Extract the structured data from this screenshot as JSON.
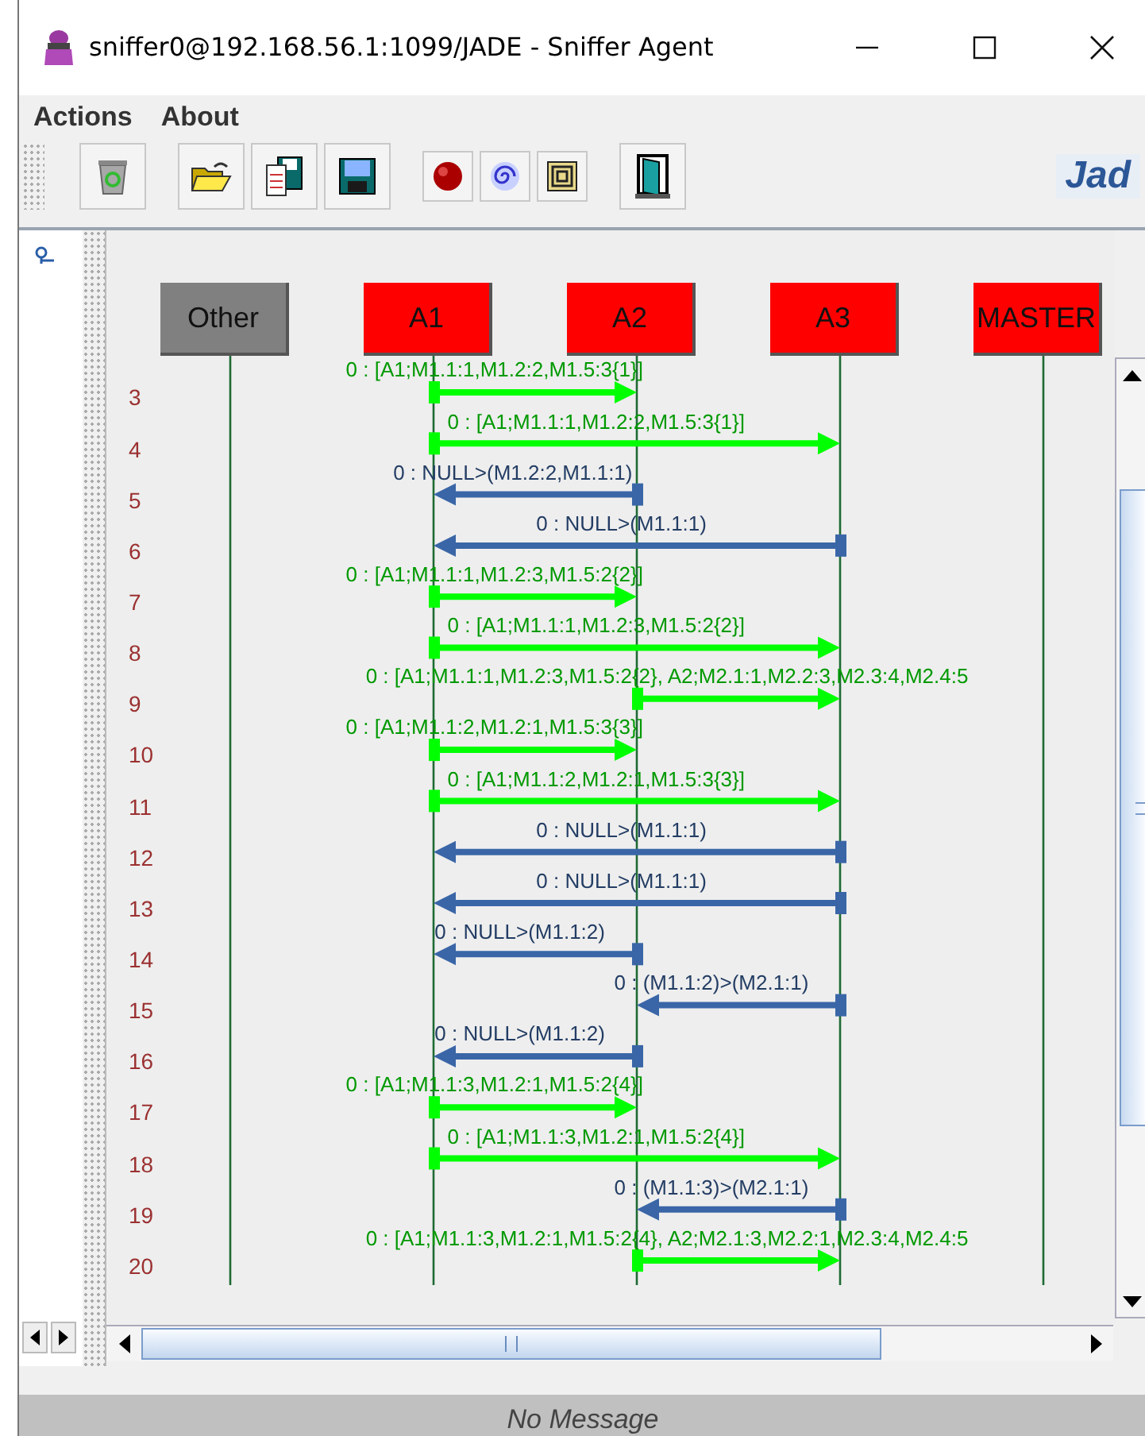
{
  "window": {
    "title": "sniffer0@192.168.56.1:1099/JADE - Sniffer Agent"
  },
  "menu": [
    "Actions",
    "About"
  ],
  "logo": "Jad",
  "agents": [
    {
      "name": "Other",
      "color": "#808080"
    },
    {
      "name": "A1",
      "color": "#ff0000"
    },
    {
      "name": "A2",
      "color": "#ff0000"
    },
    {
      "name": "A3",
      "color": "#ff0000"
    },
    {
      "name": "MASTER",
      "color": "#ff0000"
    }
  ],
  "messages": [
    {
      "row": "3",
      "kind": "a1toa2",
      "label": "0 : [A1;M1.1:1,M1.2:2,M1.5:3{1}]",
      "color": "#00ff00"
    },
    {
      "row": "4",
      "kind": "a1toa3",
      "label": "0 : [A1;M1.1:1,M1.2:2,M1.5:3{1}]",
      "color": "#00ff00"
    },
    {
      "row": "5",
      "kind": "a2toa1",
      "label": "0 : NULL>(M1.2:2,M1.1:1)",
      "color": "#3a66a7"
    },
    {
      "row": "6",
      "kind": "a3toa1",
      "label": "0 : NULL>(M1.1:1)",
      "color": "#3a66a7"
    },
    {
      "row": "7",
      "kind": "a1toa2",
      "label": "0 : [A1;M1.1:1,M1.2:3,M1.5:2{2}]",
      "color": "#00ff00"
    },
    {
      "row": "8",
      "kind": "a1toa3",
      "label": "0 : [A1;M1.1:1,M1.2:3,M1.5:2{2}]",
      "color": "#00ff00"
    },
    {
      "row": "9",
      "kind": "a2toa3",
      "label": "0 : [A1;M1.1:1,M1.2:3,M1.5:2{2}, A2;M2.1:1,M2.2:3,M2.3:4,M2.4:5",
      "color": "#00ff00"
    },
    {
      "row": "10",
      "kind": "a1toa2",
      "label": "0 : [A1;M1.1:2,M1.2:1,M1.5:3{3}]",
      "color": "#00ff00"
    },
    {
      "row": "11",
      "kind": "a1toa3",
      "label": "0 : [A1;M1.1:2,M1.2:1,M1.5:3{3}]",
      "color": "#00ff00"
    },
    {
      "row": "12",
      "kind": "a3toa1",
      "label": "0 : NULL>(M1.1:1)",
      "color": "#3a66a7"
    },
    {
      "row": "13",
      "kind": "a3toa1",
      "label": "0 : NULL>(M1.1:1)",
      "color": "#3a66a7"
    },
    {
      "row": "14",
      "kind": "a2toa1",
      "label": "0 : NULL>(M1.1:2)",
      "color": "#3a66a7"
    },
    {
      "row": "15",
      "kind": "a3toa2",
      "label": "0 : (M1.1:2)>(M2.1:1)",
      "color": "#3a66a7"
    },
    {
      "row": "16",
      "kind": "a2toa1",
      "label": "0 : NULL>(M1.1:2)",
      "color": "#3a66a7"
    },
    {
      "row": "17",
      "kind": "a1toa2",
      "label": "0 : [A1;M1.1:3,M1.2:1,M1.5:2{4}]",
      "color": "#00ff00"
    },
    {
      "row": "18",
      "kind": "a1toa3",
      "label": "0 : [A1;M1.1:3,M1.2:1,M1.5:2{4}]",
      "color": "#00ff00"
    },
    {
      "row": "19",
      "kind": "a3toa2",
      "label": "0 : (M1.1:3)>(M2.1:1)",
      "color": "#3a66a7"
    },
    {
      "row": "20",
      "kind": "a2toa3",
      "label": "0 : [A1;M1.1:3,M1.2:1,M1.5:2{4}, A2;M2.1:3,M2.2:1,M2.3:4,M2.4:5",
      "color": "#00ff00"
    }
  ],
  "status": "No Message"
}
